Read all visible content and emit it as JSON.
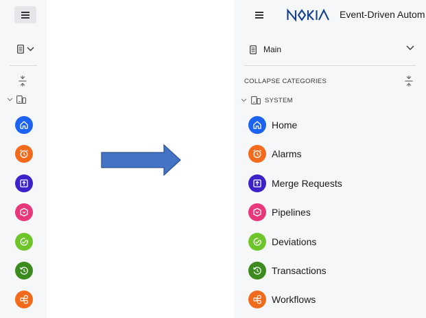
{
  "app": {
    "logo_text": "NOKIA",
    "title": "Event-Driven Autom"
  },
  "navigator": {
    "selected": "Main",
    "collapse_label": "COLLAPSE CATEGORIES",
    "category": "SYSTEM"
  },
  "nav_items": [
    {
      "label": "Home",
      "icon": "home-icon",
      "color": "#1d63f2"
    },
    {
      "label": "Alarms",
      "icon": "alarm-clock-icon",
      "color": "#f26a1b"
    },
    {
      "label": "Merge Requests",
      "icon": "merge-request-icon",
      "color": "#3b23c9"
    },
    {
      "label": "Pipelines",
      "icon": "pipeline-icon",
      "color": "#e8377a"
    },
    {
      "label": "Deviations",
      "icon": "deviation-icon",
      "color": "#6dc52a"
    },
    {
      "label": "Transactions",
      "icon": "history-icon",
      "color": "#3c8b1f"
    },
    {
      "label": "Workflows",
      "icon": "workflow-icon",
      "color": "#f26a1b"
    }
  ],
  "colors": {
    "sidebar_bg": "#f6f7f8",
    "arrow_fill": "#4472c4",
    "arrow_stroke": "#2f528f",
    "logo": "#124191"
  }
}
